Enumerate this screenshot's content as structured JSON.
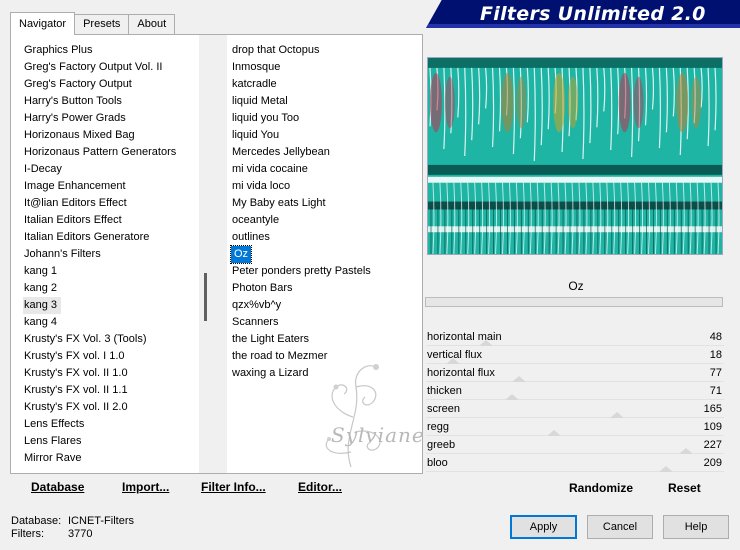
{
  "app": {
    "title": "Filters Unlimited 2.0"
  },
  "tabs": [
    {
      "label": "Navigator",
      "active": true
    },
    {
      "label": "Presets",
      "active": false
    },
    {
      "label": "About",
      "active": false
    }
  ],
  "categories": {
    "selected": "kang 3",
    "items": [
      "Graphics Plus",
      "Greg's Factory Output Vol. II",
      "Greg's Factory Output",
      "Harry's Button Tools",
      "Harry's Power Grads",
      "Horizonaus Mixed Bag",
      "Horizonaus Pattern Generators",
      "I-Decay",
      "Image Enhancement",
      "It@lian Editors Effect",
      "Italian Editors Effect",
      "Italian Editors Generatore",
      "Johann's Filters",
      "kang 1",
      "kang 2",
      "kang 3",
      "kang 4",
      "Krusty's FX Vol. 3 (Tools)",
      "Krusty's FX vol. I 1.0",
      "Krusty's FX vol. II 1.0",
      "Krusty's FX vol. II 1.1",
      "Krusty's FX vol. II 2.0",
      "Lens Effects",
      "Lens Flares",
      "Mirror Rave"
    ]
  },
  "filters": {
    "selected": "Oz",
    "items": [
      "drop that Octopus",
      "Inmosque",
      "katcradle",
      "liquid Metal",
      "liquid you Too",
      "liquid You",
      "Mercedes Jellybean",
      "mi vida cocaine",
      "mi vida loco",
      "My Baby eats Light",
      "oceantyle",
      "outlines",
      "Oz",
      "Peter ponders pretty Pastels",
      "Photon Bars",
      "qzx%vb^y",
      "Scanners",
      "the Light Eaters",
      "the road to Mezmer",
      "waxing a Lizard"
    ]
  },
  "watermark_text": "Sylviane",
  "bottom_links": {
    "database": "Database",
    "import": "Import...",
    "filter_info": "Filter Info...",
    "editor": "Editor..."
  },
  "preview": {
    "filter_name": "Oz"
  },
  "params": [
    {
      "name": "horizontal main",
      "value": 48
    },
    {
      "name": "vertical flux",
      "value": 18
    },
    {
      "name": "horizontal flux",
      "value": 77
    },
    {
      "name": "thicken",
      "value": 71
    },
    {
      "name": "screen",
      "value": 165
    },
    {
      "name": "regg",
      "value": 109
    },
    {
      "name": "greeb",
      "value": 227
    },
    {
      "name": "bloo",
      "value": 209
    }
  ],
  "param_max": 255,
  "right_links": {
    "randomize": "Randomize",
    "reset": "Reset"
  },
  "status": {
    "database_label": "Database:",
    "database_value": "ICNET-Filters",
    "filters_label": "Filters:",
    "filters_value": "3770"
  },
  "buttons": {
    "apply": "Apply",
    "cancel": "Cancel",
    "help": "Help"
  },
  "colors": {
    "banner": "#001070",
    "selection": "#0078d7",
    "preview_teal": "#1fb5a5"
  }
}
